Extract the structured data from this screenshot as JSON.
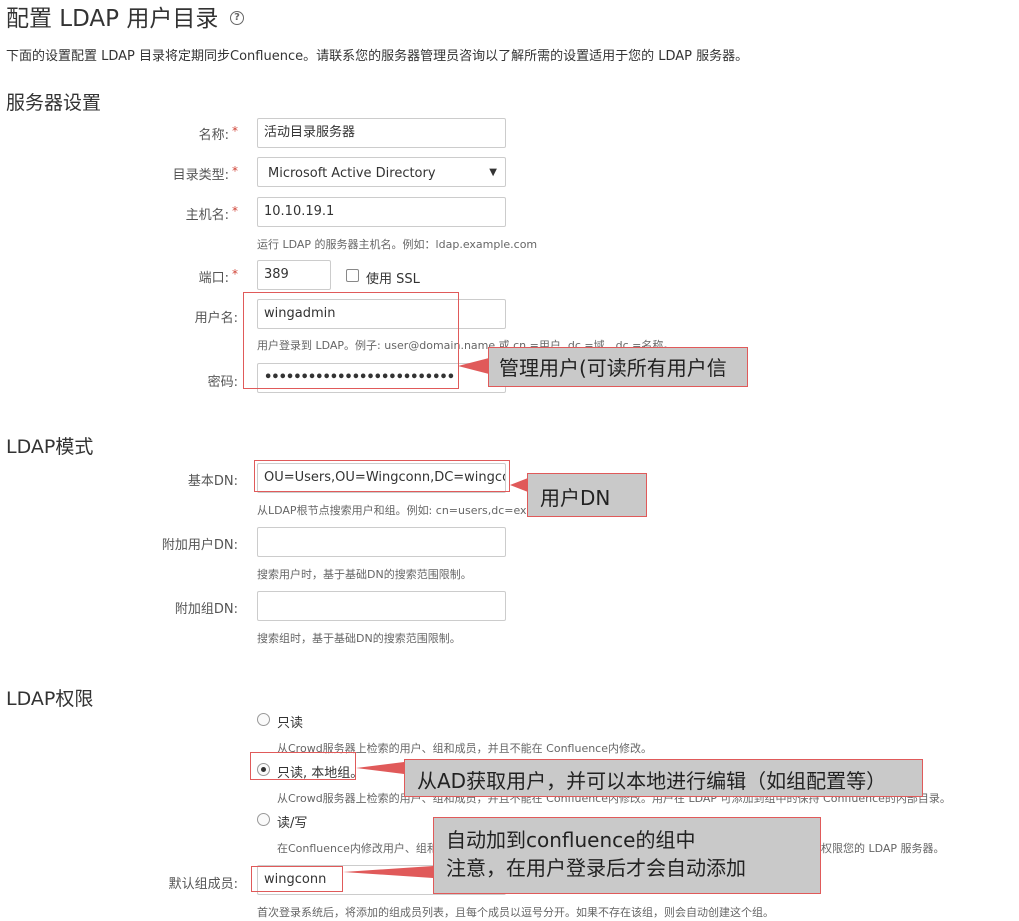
{
  "page": {
    "title": "配置 LDAP 用户目录",
    "intro": "下面的设置配置 LDAP 目录将定期同步Confluence。请联系您的服务器管理员咨询以了解所需的设置适用于您的 LDAP 服务器。",
    "required_mark": "*"
  },
  "server_settings": {
    "heading": "服务器设置",
    "name": {
      "label": "名称:",
      "value": "活动目录服务器"
    },
    "dir_type": {
      "label": "目录类型:",
      "value": "Microsoft Active Directory"
    },
    "hostname": {
      "label": "主机名:",
      "value": "10.10.19.1",
      "hint": "运行 LDAP 的服务器主机名。例如：ldap.example.com"
    },
    "port": {
      "label": "端口:",
      "value": "389",
      "ssl_label": "使用 SSL"
    },
    "username": {
      "label": "用户名:",
      "value": "wingadmin",
      "hint": "用户登录到 LDAP。例子: user@domain.name 或 cn =用户, dc =域、dc =名称。"
    },
    "password": {
      "label": "密码:",
      "value": "••••••••••••••••••••••••••"
    }
  },
  "ldap_schema": {
    "heading": "LDAP模式",
    "base_dn": {
      "label": "基本DN:",
      "value": "OU=Users,OU=Wingconn,DC=wingcon",
      "hint": "从LDAP根节点搜索用户和组。例如: cn=users,dc=example,dc=com。"
    },
    "extra_user_dn": {
      "label": "附加用户DN:",
      "value": "",
      "hint": "搜索用户时，基于基础DN的搜索范围限制。"
    },
    "extra_group_dn": {
      "label": "附加组DN:",
      "value": "",
      "hint": "搜索组时，基于基础DN的搜索范围限制。"
    }
  },
  "ldap_permissions": {
    "heading": "LDAP权限",
    "options": [
      {
        "label": "只读",
        "hint": "从Crowd服务器上检索的用户、组和成员，并且不能在 Confluence内修改。"
      },
      {
        "label": "只读, 本地组。",
        "hint": "从Crowd服务器上检索的用户、组和成员，并且不能在 Confluence内修改。用户在 LDAP 可添加到组中的保持 Confluence的内部目录。"
      },
      {
        "label": "读/写",
        "hint": "在Confluence内修改用户、组和成员，并将这些修改写回到您的LDAP服务器。请配置的 LDAP 用户将需要修改权限您的 LDAP 服务器。"
      }
    ],
    "selected": "只读, 本地组。",
    "default_groups": {
      "label": "默认组成员:",
      "value": "wingconn",
      "hint": "首次登录系统后，将添加的组成员列表，且每个成员以逗号分开。如果不存在该组，则会自动创建这个组。"
    }
  },
  "annotations": {
    "admin_user": "管理用户(可读所有用户信",
    "user_dn": "用户DN",
    "local_groups": "从AD获取用户，并可以本地进行编辑（如组配置等）",
    "auto_add_line1": "自动加到confluence的组中",
    "auto_add_line2": "注意，在用户登录后才会自动添加"
  },
  "colors": {
    "annotation_border": "#e05a5a",
    "annotation_fill": "#c9c9c9",
    "required": "#d04437"
  },
  "icons": {
    "help": "help-icon",
    "dropdown": "chevron-down-icon"
  }
}
